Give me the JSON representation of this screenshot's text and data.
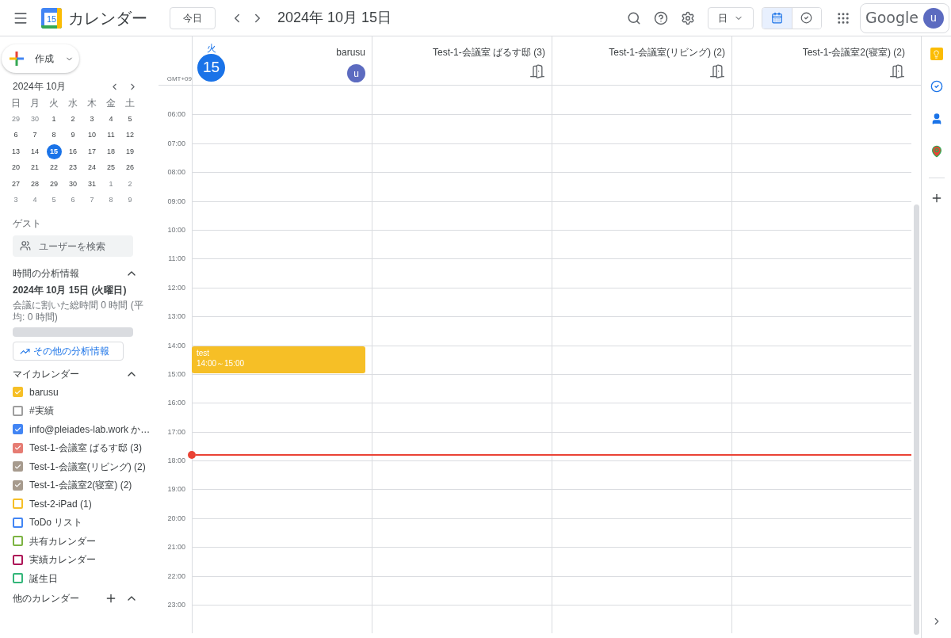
{
  "header": {
    "logo_day": "15",
    "app_title": "カレンダー",
    "today_button": "今日",
    "date_title": "2024年 10月 15日",
    "view_select": "日",
    "account_brand": "Google",
    "account_initial": "u",
    "view_toggle": [
      {
        "kind": "calendar",
        "selected": true
      },
      {
        "kind": "tasks",
        "selected": false
      }
    ]
  },
  "sidebar": {
    "create_button": "作成",
    "mini_calendar": {
      "title": "2024年 10月",
      "weekdays": [
        "日",
        "月",
        "火",
        "水",
        "木",
        "金",
        "土"
      ],
      "weeks": [
        [
          {
            "day": "29",
            "muted": true,
            "selected": false
          },
          {
            "day": "30",
            "muted": true,
            "selected": false
          },
          {
            "day": "1",
            "muted": false,
            "selected": false
          },
          {
            "day": "2",
            "muted": false,
            "selected": false
          },
          {
            "day": "3",
            "muted": false,
            "selected": false
          },
          {
            "day": "4",
            "muted": false,
            "selected": false
          },
          {
            "day": "5",
            "muted": false,
            "selected": false
          }
        ],
        [
          {
            "day": "6",
            "muted": false,
            "selected": false
          },
          {
            "day": "7",
            "muted": false,
            "selected": false
          },
          {
            "day": "8",
            "muted": false,
            "selected": false
          },
          {
            "day": "9",
            "muted": false,
            "selected": false
          },
          {
            "day": "10",
            "muted": false,
            "selected": false
          },
          {
            "day": "11",
            "muted": false,
            "selected": false
          },
          {
            "day": "12",
            "muted": false,
            "selected": false
          }
        ],
        [
          {
            "day": "13",
            "muted": false,
            "selected": false
          },
          {
            "day": "14",
            "muted": false,
            "selected": false
          },
          {
            "day": "15",
            "muted": false,
            "selected": true
          },
          {
            "day": "16",
            "muted": false,
            "selected": false
          },
          {
            "day": "17",
            "muted": false,
            "selected": false
          },
          {
            "day": "18",
            "muted": false,
            "selected": false
          },
          {
            "day": "19",
            "muted": false,
            "selected": false
          }
        ],
        [
          {
            "day": "20",
            "muted": false,
            "selected": false
          },
          {
            "day": "21",
            "muted": false,
            "selected": false
          },
          {
            "day": "22",
            "muted": false,
            "selected": false
          },
          {
            "day": "23",
            "muted": false,
            "selected": false
          },
          {
            "day": "24",
            "muted": false,
            "selected": false
          },
          {
            "day": "25",
            "muted": false,
            "selected": false
          },
          {
            "day": "26",
            "muted": false,
            "selected": false
          }
        ],
        [
          {
            "day": "27",
            "muted": false,
            "selected": false
          },
          {
            "day": "28",
            "muted": false,
            "selected": false
          },
          {
            "day": "29",
            "muted": false,
            "selected": false
          },
          {
            "day": "30",
            "muted": false,
            "selected": false
          },
          {
            "day": "31",
            "muted": false,
            "selected": false
          },
          {
            "day": "1",
            "muted": true,
            "selected": false
          },
          {
            "day": "2",
            "muted": true,
            "selected": false
          }
        ],
        [
          {
            "day": "3",
            "muted": true,
            "selected": false
          },
          {
            "day": "4",
            "muted": true,
            "selected": false
          },
          {
            "day": "5",
            "muted": true,
            "selected": false
          },
          {
            "day": "6",
            "muted": true,
            "selected": false
          },
          {
            "day": "7",
            "muted": true,
            "selected": false
          },
          {
            "day": "8",
            "muted": true,
            "selected": false
          },
          {
            "day": "9",
            "muted": true,
            "selected": false
          }
        ]
      ]
    },
    "guests": {
      "heading": "ゲスト",
      "search": {
        "placeholder": "ユーザーを検索"
      }
    },
    "insights": {
      "heading": "時間の分析情報",
      "expanded": true,
      "date": "2024年 10月 15日 (火曜日)",
      "summary": "会議に割いた総時間 0 時間 (平均: 0 時間)",
      "bar": {
        "level": 0
      },
      "more_button": "その他の分析情報"
    },
    "my_calendars": {
      "heading": "マイカレンダー",
      "expanded": true,
      "items": [
        {
          "name": "barusu",
          "color": "#f6bf26",
          "checked": true
        },
        {
          "name": "#実績",
          "color": "#9e9e9e",
          "checked": false
        },
        {
          "name": "info@pleiades-lab.work か…",
          "color": "#4285f4",
          "checked": true
        },
        {
          "name": "Test-1-会議室 ばるす邸 (3)",
          "color": "#e67c73",
          "checked": true
        },
        {
          "name": "Test-1-会議室(リビング) (2)",
          "color": "#a79b8e",
          "checked": true
        },
        {
          "name": "Test-1-会議室2(寝室) (2)",
          "color": "#a79b8e",
          "checked": true
        },
        {
          "name": "Test-2-iPad (1)",
          "color": "#f6bf26",
          "checked": false
        },
        {
          "name": "ToDo リスト",
          "color": "#4285f4",
          "checked": false
        },
        {
          "name": "共有カレンダー",
          "color": "#7cb342",
          "checked": false
        },
        {
          "name": "実績カレンダー",
          "color": "#ad1457",
          "checked": false
        },
        {
          "name": "誕生日",
          "color": "#33b679",
          "checked": false
        }
      ]
    },
    "other_calendars": {
      "heading": "他のカレンダー",
      "expanded": true
    }
  },
  "day_view": {
    "weekday": "火",
    "day": "15",
    "timezone": "GMT+09",
    "columns": [
      {
        "kind": "person",
        "name": "barusu",
        "initial": "u"
      },
      {
        "kind": "room",
        "name": "Test-1-会議室 ばるす邸 (3)"
      },
      {
        "kind": "room",
        "name": "Test-1-会議室(リビング) (2)"
      },
      {
        "kind": "room",
        "name": "Test-1-会議室2(寝室) (2)"
      }
    ],
    "hours": [
      {
        "label": "06:00",
        "current_time": false
      },
      {
        "label": "07:00",
        "current_time": false
      },
      {
        "label": "08:00",
        "current_time": false
      },
      {
        "label": "09:00",
        "current_time": false
      },
      {
        "label": "10:00",
        "current_time": false
      },
      {
        "label": "11:00",
        "current_time": false
      },
      {
        "label": "12:00",
        "current_time": false
      },
      {
        "label": "13:00",
        "current_time": false
      },
      {
        "label": "14:00",
        "current_time": false,
        "events": [
          {
            "title": "test",
            "time": "14:00～15:00",
            "color": "#f6bf26"
          }
        ]
      },
      {
        "label": "15:00",
        "current_time": false
      },
      {
        "label": "16:00",
        "current_time": false
      },
      {
        "label": "17:00",
        "current_time": true
      },
      {
        "label": "18:00",
        "current_time": false
      },
      {
        "label": "19:00",
        "current_time": false
      },
      {
        "label": "20:00",
        "current_time": false
      },
      {
        "label": "21:00",
        "current_time": false
      },
      {
        "label": "22:00",
        "current_time": false
      },
      {
        "label": "23:00",
        "current_time": false
      }
    ]
  }
}
